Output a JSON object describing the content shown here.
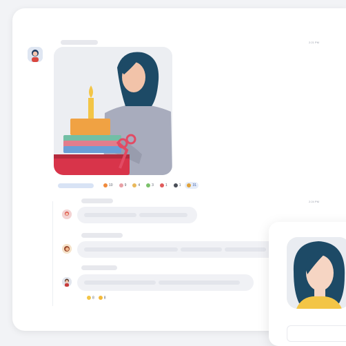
{
  "colors": {
    "accent": "#3e5fa8",
    "bubble": "#f0f1f5",
    "placeholder": "#e7e8ed"
  },
  "message": {
    "time": "2:21 PM",
    "image_icon": "birthday-cake-illustration"
  },
  "reactions": [
    {
      "icon": "fire-icon",
      "count": "10",
      "color": "#f08a3c"
    },
    {
      "icon": "cake-icon",
      "count": "9",
      "color": "#e8a0a5"
    },
    {
      "icon": "clap-icon",
      "count": "4",
      "color": "#e9b85b"
    },
    {
      "icon": "party-icon",
      "count": "3",
      "color": "#7cc16b"
    },
    {
      "icon": "heart-icon",
      "count": "1",
      "color": "#e05b5b"
    },
    {
      "icon": "gift-icon",
      "count": "1",
      "color": "#4a4e57"
    },
    {
      "icon": "thumbs-up-icon",
      "count": "31",
      "color": "#e0a23a",
      "active": true
    }
  ],
  "thread": {
    "time": "2:24 PM",
    "small_reactions": [
      {
        "icon": "grin-icon",
        "count": "8",
        "color": "#f3c546"
      },
      {
        "icon": "sunglasses-icon",
        "count": "8",
        "color": "#f3b93a"
      }
    ]
  }
}
